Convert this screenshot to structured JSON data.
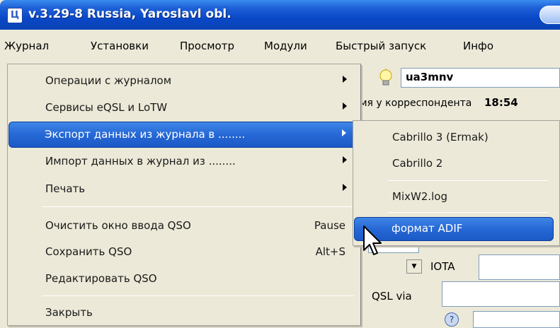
{
  "window": {
    "title": "v.3.29-8 Russia, Yaroslavl obl.",
    "app_icon_text": "Ц"
  },
  "menubar": [
    "Журнал",
    "Установки",
    "Просмотр",
    "Модули",
    "Быстрый запуск",
    "Инфо"
  ],
  "main_menu": {
    "items": [
      {
        "label": "Операции с журналом",
        "submenu": true
      },
      {
        "label": "Сервисы eQSL и LoTW",
        "submenu": true
      },
      {
        "label": "Экспорт данных из журнала в ........",
        "submenu": true,
        "highlighted": true
      },
      {
        "label": "Импорт данных в журнал из ........",
        "submenu": true
      },
      {
        "label": "Печать",
        "submenu": true
      },
      {
        "label": "Очистить окно ввода QSO",
        "shortcut": "Pause"
      },
      {
        "label": "Сохранить QSO",
        "shortcut": "Alt+S"
      },
      {
        "label": "Редактировать QSO"
      },
      {
        "label": "Закрыть"
      }
    ]
  },
  "sub_menu": {
    "items": [
      {
        "label": "Cabrillo 3 (Ermak)"
      },
      {
        "label": "Cabrillo 2"
      },
      {
        "label": "MixW2.log"
      },
      {
        "label": "формат ADIF",
        "highlighted": true
      }
    ]
  },
  "background": {
    "callsign": "ua3mnv",
    "corr_time_label": "мя у корреспондента",
    "corr_time_value": "18:54",
    "iota_label": "IOTA",
    "qslvia_label": "QSL via",
    "help_text": "?"
  },
  "colors": {
    "titlebar": "#0a48c8",
    "highlight": "#2668d6",
    "menu_bg": "#ece9d8"
  }
}
